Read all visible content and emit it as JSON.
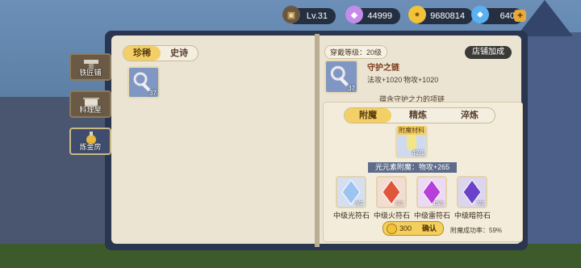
{
  "topbar": {
    "level": "Lv.31",
    "diamonds": "44999",
    "gold": "9680814",
    "energy": "640"
  },
  "side_tabs": [
    {
      "label": "铁匠铺"
    },
    {
      "label": "料理屋"
    },
    {
      "label": "炼金房"
    }
  ],
  "left_page": {
    "tabs": [
      "珍稀",
      "史诗"
    ],
    "item_count": "37"
  },
  "right_page": {
    "wear_level": "穿戴等级：20级",
    "shop_bonus": "店铺加成",
    "item_name": "守护之链",
    "item_count": "37",
    "stat1": "法攻+1020",
    "stat2": "物攻+1020",
    "description": "蕴含守护之力的项链",
    "tabs": [
      "附魔",
      "精炼",
      "淬炼"
    ],
    "material_label": "附魔材料",
    "material_count": "42/1",
    "enchant_effect": "光元素附魔：物攻+265",
    "gems": [
      {
        "name": "中级光符石",
        "count": "9/2",
        "color": "#9bc4f0"
      },
      {
        "name": "中级火符石",
        "count": "8/2",
        "color": "#e0563a"
      },
      {
        "name": "中级雷符石",
        "count": "15/2",
        "color": "#b640d9"
      },
      {
        "name": "中级暗符石",
        "count": "7/2",
        "color": "#6b43c9"
      }
    ],
    "cost": "300",
    "confirm": "确认",
    "success_rate": "附魔成功率：59%"
  }
}
